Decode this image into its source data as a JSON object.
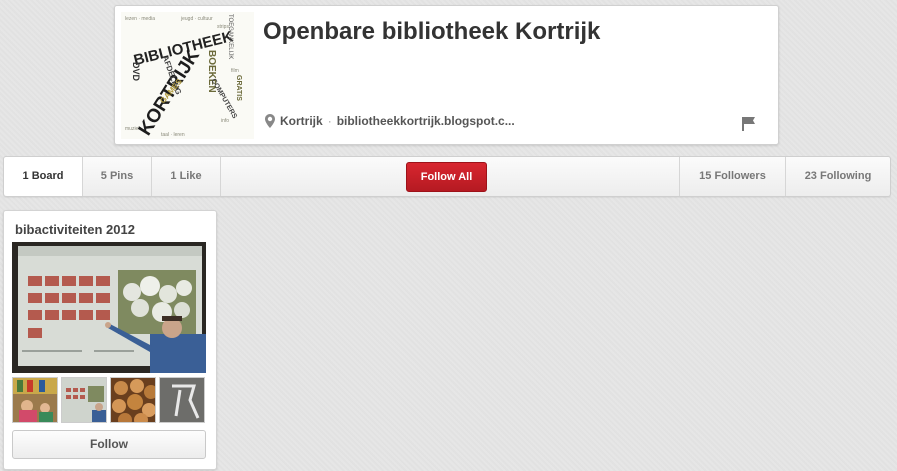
{
  "profile": {
    "name": "Openbare bibliotheek Kortrijk",
    "location": "Kortrijk",
    "separator": "·",
    "website": "bibliotheekkortrijk.blogspot.c...",
    "avatar_words": [
      "BIBLIOTHEEK",
      "KORTRIJK",
      "BOEKEN",
      "AFDELING",
      "GAMES",
      "COMPUTERS",
      "DVD",
      "TOEGANKELIJK",
      "GRATIS"
    ]
  },
  "nav": {
    "boards": "1 Board",
    "pins": "5 Pins",
    "likes": "1 Like",
    "follow_all": "Follow All",
    "followers": "15 Followers",
    "following": "23 Following"
  },
  "board": {
    "title": "bibactiviteiten 2012",
    "follow_label": "Follow"
  },
  "colors": {
    "accent_red": "#c8202a",
    "background": "#e5e5e5"
  },
  "icons": {
    "location": "map-pin-icon",
    "flag": "flag-icon"
  }
}
